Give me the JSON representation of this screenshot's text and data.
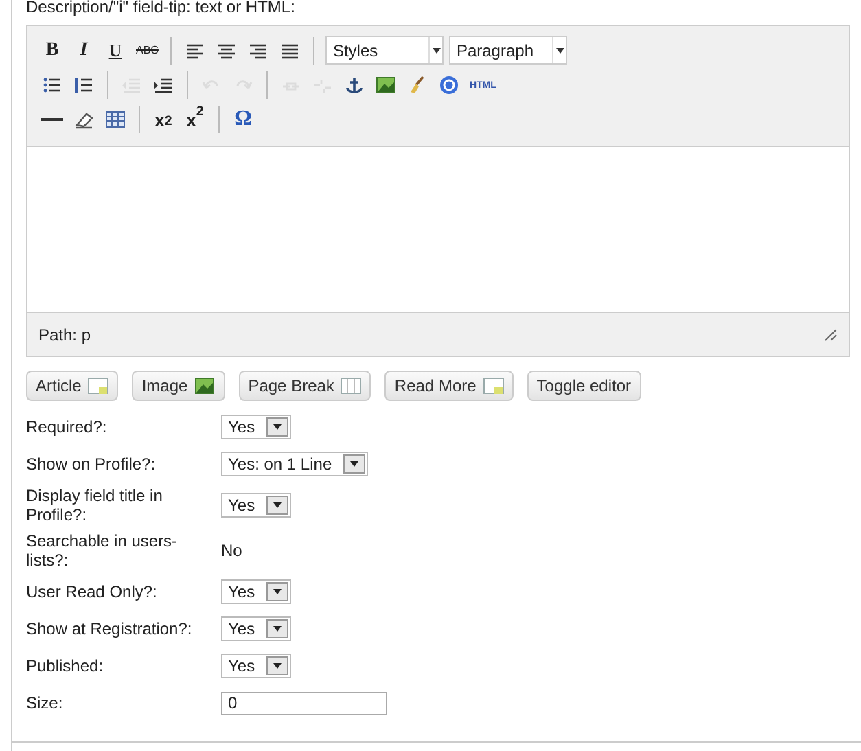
{
  "heading": "Description/\"i\" field-tip: text or HTML:",
  "toolbar": [
    [
      {
        "kind": "bold",
        "label": "B"
      },
      {
        "kind": "italic",
        "label": "I"
      },
      {
        "kind": "underline",
        "label": "U"
      },
      {
        "kind": "strike",
        "label": "ABC"
      },
      {
        "kind": "sep"
      },
      {
        "kind": "align-left"
      },
      {
        "kind": "align-center"
      },
      {
        "kind": "align-right"
      },
      {
        "kind": "justify"
      },
      {
        "kind": "sep"
      },
      {
        "kind": "select",
        "label": "Styles"
      },
      {
        "kind": "select",
        "label": "Paragraph"
      }
    ],
    [
      {
        "kind": "bullets"
      },
      {
        "kind": "numbers"
      },
      {
        "kind": "sep"
      },
      {
        "kind": "outdent",
        "disabled": true
      },
      {
        "kind": "indent",
        "disabled": false
      },
      {
        "kind": "sep"
      },
      {
        "kind": "undo",
        "disabled": true
      },
      {
        "kind": "redo",
        "disabled": true
      },
      {
        "kind": "sep"
      },
      {
        "kind": "link",
        "disabled": true
      },
      {
        "kind": "unlink",
        "disabled": true
      },
      {
        "kind": "anchor",
        "disabled": false
      },
      {
        "kind": "image",
        "disabled": false
      },
      {
        "kind": "cleanup",
        "disabled": false
      },
      {
        "kind": "help",
        "disabled": false
      },
      {
        "kind": "html",
        "label": "HTML"
      }
    ],
    [
      {
        "kind": "rule"
      },
      {
        "kind": "eraser"
      },
      {
        "kind": "table"
      },
      {
        "kind": "sep"
      },
      {
        "kind": "script",
        "label": "x$_{2}$"
      },
      {
        "kind": "script",
        "label": "x$^{2}$"
      },
      {
        "kind": "sep"
      },
      {
        "kind": "symbol",
        "label": "Ω"
      }
    ]
  ],
  "path": "Path: p",
  "buttons": [
    {
      "label": "Article",
      "kind": "article"
    },
    {
      "label": "Image",
      "kind": "image"
    },
    {
      "label": "Page Break",
      "kind": "pagebreak"
    },
    {
      "label": "Read More",
      "kind": "article"
    },
    {
      "label": "Toggle editor",
      "kind": "plain"
    }
  ],
  "fields": [
    {
      "kind": "select",
      "label": "Required?:",
      "value": "Yes"
    },
    {
      "kind": "select",
      "label": "Show on Profile?:",
      "value": "Yes: on 1 Line"
    },
    {
      "kind": "select",
      "label": "Display field title in Profile?:",
      "value": "Yes"
    },
    {
      "kind": "text",
      "label": "Searchable in users-lists?:",
      "value": "No"
    },
    {
      "kind": "select",
      "label": "User Read Only?:",
      "value": "Yes"
    },
    {
      "kind": "select",
      "label": "Show at Registration?:",
      "value": "Yes"
    },
    {
      "kind": "select",
      "label": "Published:",
      "value": "Yes"
    },
    {
      "kind": "input",
      "label": "Size:",
      "value": "0"
    }
  ]
}
